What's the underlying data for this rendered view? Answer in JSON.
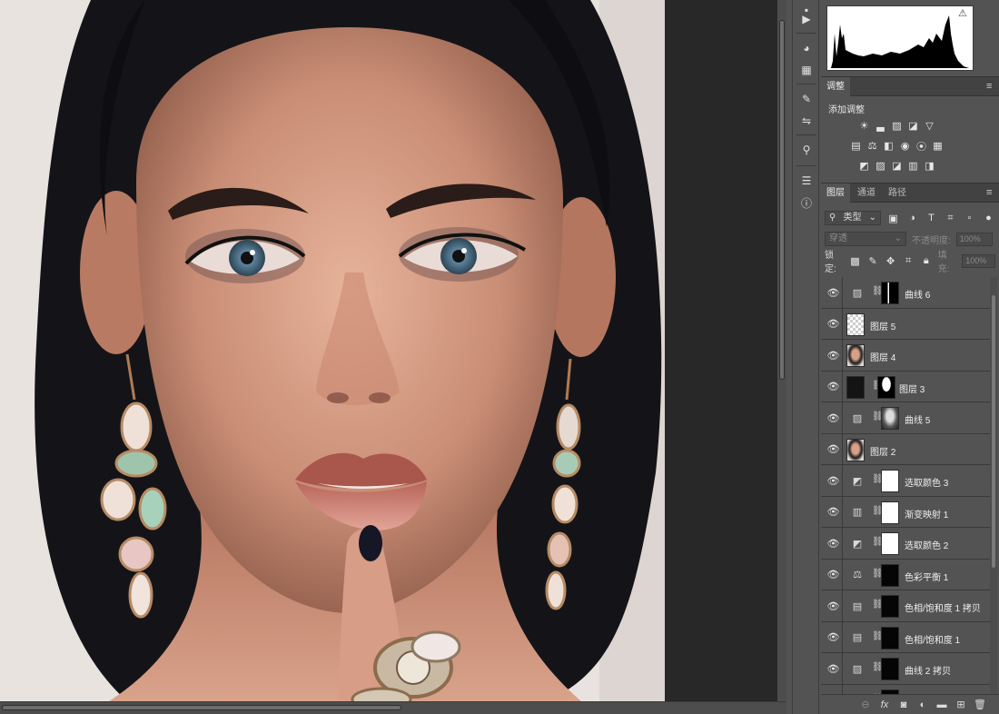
{
  "histogram": {
    "warning_icon": "warning-triangle-icon"
  },
  "adjustments": {
    "tab": "调整",
    "add_label": "添加调整",
    "row1": [
      "brightness-icon",
      "levels-icon",
      "curves-icon",
      "exposure-icon",
      "vibrance-icon"
    ],
    "row2": [
      "hue-saturation-icon",
      "color-balance-icon",
      "black-white-icon",
      "photo-filter-icon",
      "channel-mixer-icon",
      "color-lookup-icon"
    ],
    "row3": [
      "invert-icon",
      "posterize-icon",
      "threshold-icon",
      "gradient-map-icon",
      "selective-color-icon"
    ]
  },
  "layers_panel": {
    "tabs": [
      "图层",
      "通道",
      "路径"
    ],
    "filter_label": "类型",
    "blend_mode": "穿透",
    "opacity_label": "不透明度:",
    "opacity_value": "100%",
    "lock_label": "锁定:",
    "fill_label": "填充:",
    "fill_value": "100%"
  },
  "layers": [
    {
      "name": "曲线 6",
      "type": "adjustment",
      "icon": "curves-icon",
      "mask": "black-with-white"
    },
    {
      "name": "图层 5",
      "type": "pixel",
      "thumb": "transparent"
    },
    {
      "name": "图层 4",
      "type": "pixel",
      "thumb": "face"
    },
    {
      "name": "图层 3",
      "type": "pixel-masked",
      "thumb": "dark",
      "mask": "silhouette"
    },
    {
      "name": "曲线 5",
      "type": "adjustment",
      "icon": "curves-icon",
      "mask": "face-gray"
    },
    {
      "name": "图层 2",
      "type": "pixel",
      "thumb": "face"
    },
    {
      "name": "选取颜色 3",
      "type": "adjustment",
      "icon": "selective-color-icon",
      "mask": "white"
    },
    {
      "name": "渐变映射 1",
      "type": "adjustment",
      "icon": "gradient-map-icon",
      "mask": "white"
    },
    {
      "name": "选取颜色 2",
      "type": "adjustment",
      "icon": "selective-color-icon",
      "mask": "white"
    },
    {
      "name": "色彩平衡 1",
      "type": "adjustment",
      "icon": "color-balance-icon",
      "mask": "black"
    },
    {
      "name": "色相/饱和度 1 拷贝",
      "type": "adjustment",
      "icon": "hue-saturation-icon",
      "mask": "black"
    },
    {
      "name": "色相/饱和度 1",
      "type": "adjustment",
      "icon": "hue-saturation-icon",
      "mask": "black"
    },
    {
      "name": "曲线 2 拷贝",
      "type": "adjustment",
      "icon": "curves-icon",
      "mask": "black"
    },
    {
      "name": "",
      "type": "adjustment",
      "icon": "curves-icon",
      "mask": "black"
    }
  ]
}
